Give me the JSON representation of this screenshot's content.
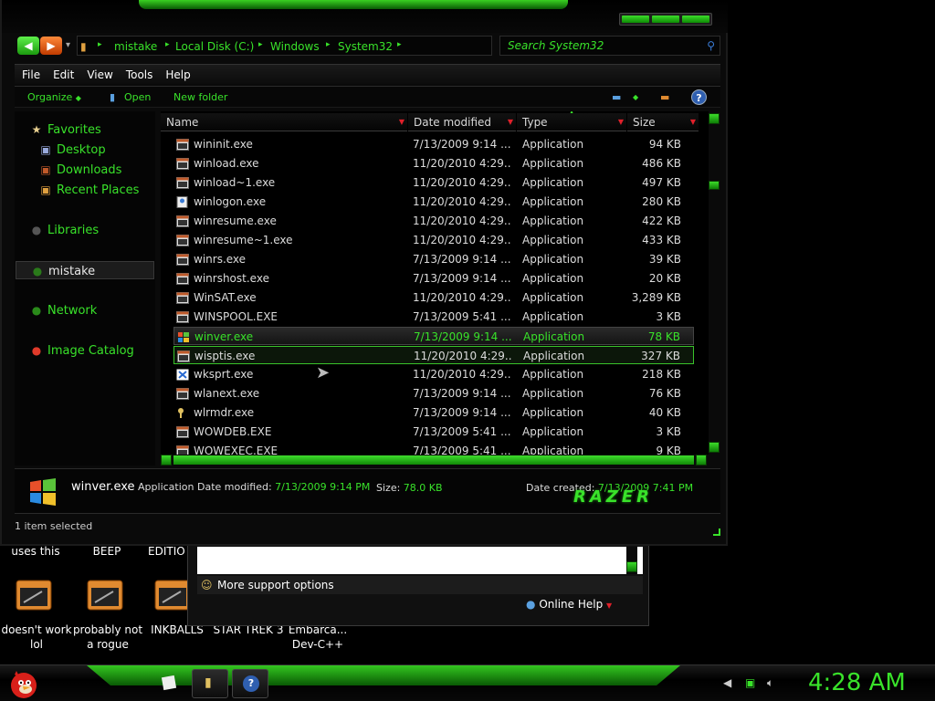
{
  "window": {
    "nav": {
      "back_label": "◀",
      "forward_label": "▶",
      "recent_arrow": "▾"
    },
    "address": {
      "crumbs": [
        "mistake",
        "Local Disk (C:)",
        "Windows",
        "System32"
      ],
      "search_placeholder": "Search System32"
    },
    "menu": [
      "File",
      "Edit",
      "View",
      "Tools",
      "Help"
    ],
    "toolbar": {
      "organize": "Organize",
      "open": "Open",
      "new_folder": "New folder"
    },
    "navpane": {
      "favorites": "Favorites",
      "desktop": "Desktop",
      "downloads": "Downloads",
      "recent_places": "Recent Places",
      "libraries": "Libraries",
      "user": "mistake",
      "network": "Network",
      "image_catalog": "Image Catalog"
    },
    "columns": {
      "name": "Name",
      "date": "Date modified",
      "type": "Type",
      "size": "Size"
    },
    "files": [
      {
        "name": "wininit.exe",
        "date": "7/13/2009 9:14 ...",
        "type": "Application",
        "size": "94 KB",
        "icon": "app-icon"
      },
      {
        "name": "winload.exe",
        "date": "11/20/2010 4:29...",
        "type": "Application",
        "size": "486 KB",
        "icon": "app-icon"
      },
      {
        "name": "winload~1.exe",
        "date": "11/20/2010 4:29...",
        "type": "Application",
        "size": "497 KB",
        "icon": "app-icon"
      },
      {
        "name": "winlogon.exe",
        "date": "11/20/2010 4:29...",
        "type": "Application",
        "size": "280 KB",
        "icon": "winlogon-icon"
      },
      {
        "name": "winresume.exe",
        "date": "11/20/2010 4:29...",
        "type": "Application",
        "size": "422 KB",
        "icon": "app-icon"
      },
      {
        "name": "winresume~1.exe",
        "date": "11/20/2010 4:29...",
        "type": "Application",
        "size": "433 KB",
        "icon": "app-icon"
      },
      {
        "name": "winrs.exe",
        "date": "7/13/2009 9:14 ...",
        "type": "Application",
        "size": "39 KB",
        "icon": "app-icon"
      },
      {
        "name": "winrshost.exe",
        "date": "7/13/2009 9:14 ...",
        "type": "Application",
        "size": "20 KB",
        "icon": "app-icon"
      },
      {
        "name": "WinSAT.exe",
        "date": "11/20/2010 4:29...",
        "type": "Application",
        "size": "3,289 KB",
        "icon": "app-icon"
      },
      {
        "name": "WINSPOOL.EXE",
        "date": "7/13/2009 5:41 ...",
        "type": "Application",
        "size": "3 KB",
        "icon": "app-icon"
      },
      {
        "name": "winver.exe",
        "date": "7/13/2009 9:14 ...",
        "type": "Application",
        "size": "78 KB",
        "icon": "windows-logo-icon"
      },
      {
        "name": "wisptis.exe",
        "date": "11/20/2010 4:29...",
        "type": "Application",
        "size": "327 KB",
        "icon": "app-icon"
      },
      {
        "name": "wksprt.exe",
        "date": "11/20/2010 4:29...",
        "type": "Application",
        "size": "218 KB",
        "icon": "wksprt-icon"
      },
      {
        "name": "wlanext.exe",
        "date": "7/13/2009 9:14 ...",
        "type": "Application",
        "size": "76 KB",
        "icon": "app-icon"
      },
      {
        "name": "wlrmdr.exe",
        "date": "7/13/2009 9:14 ...",
        "type": "Application",
        "size": "40 KB",
        "icon": "key-icon"
      },
      {
        "name": "WOWDEB.EXE",
        "date": "7/13/2009 5:41 ...",
        "type": "Application",
        "size": "3 KB",
        "icon": "app-icon"
      },
      {
        "name": "WOWEXEC.EXE",
        "date": "7/13/2009 5:41 ...",
        "type": "Application",
        "size": "9 KB",
        "icon": "app-icon"
      }
    ],
    "hover_row": 10,
    "selected_row": 11,
    "details": {
      "name": "winver.exe",
      "type": "Application",
      "date_modified_label": "Date modified:",
      "date_modified": "7/13/2009 9:14 PM",
      "size_label": "Size:",
      "size": "78.0 KB",
      "date_created_label": "Date created:",
      "date_created": "7/13/2009 7:41 PM",
      "brand": "RAZER"
    },
    "status": "1 item selected"
  },
  "help_window": {
    "support": "More support options",
    "online_help": "Online Help"
  },
  "desktop": {
    "top_labels": [
      "uses this",
      "BEEP",
      "EDITIO"
    ],
    "icons": [
      {
        "label": "doesn't work lol"
      },
      {
        "label": "probably not a rogue"
      },
      {
        "label": "INKBALLS"
      },
      {
        "label": "STAR TREK 3"
      },
      {
        "label": "Embarca... Dev-C++"
      }
    ]
  },
  "taskbar": {
    "clock": "4:28 AM"
  },
  "colors": {
    "accent": "#39e22a",
    "background": "#000000",
    "sort_arrow": "#e0202a"
  }
}
